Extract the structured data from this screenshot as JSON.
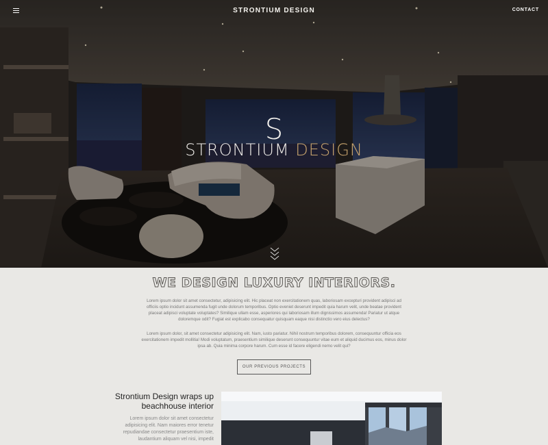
{
  "header": {
    "menu_icon": "hamburger-menu-icon",
    "brand": "STRONTIUM DESIGN",
    "contact": "CONTACT"
  },
  "hero": {
    "logo_letter": "S",
    "logo_word_1": "STRONTIUM",
    "logo_word_2": "DESIGN",
    "scroll_icon": "chevron-down-icon"
  },
  "intro": {
    "headline": "WE DESIGN LUXURY INTERIORS.",
    "paragraph_1": "Lorem ipsum dolor sit amet consectetur, adipisicing elit. Hic placeat non exercitationem quas, laboriosam excepturi provident adipisci ad officiis optio incidunt assumenda fugit unde dolorum temporibus. Optio eveniet deserunt impedit quia harum velit, unde beatae provident placeat adipisci voluptate voluptates? Similique ullam esse, asperiores qui laboriosam illum dignissimos assumenda! Pariatur ut atque doloremque odit? Fugiat est explicabo consequatur quisquam eaque nisi distinctio vero eius delectus?",
    "paragraph_2": "Lorem ipsum dolor, sit amet consectetur adipisicing elit. Nam, iusto pariatur. Nihil nostrum temporibus dolorem, consequuntur officia eos exercitationem impedit mollitia! Modi voluptatum, praesentium similique deserunt consequuntur vitae eum et aliquid ducimus eos, minus dolor ipsa ab. Quia minima corpore harum. Cum esse id facere eligendi nemo velit qui?",
    "button": "OUR PREVIOUS PROJECTS"
  },
  "feature": {
    "title": "Strontium Design wraps up beachhouse interior",
    "text": "Lorem ipsum dolor sit amet consectetur adipisicing elit. Nam maiores error tenetur repudiandae consectetur praesentium iste, laudantium aliquam vel nisi, impedit"
  },
  "colors": {
    "accent_gold": "#c9a56e",
    "page_bg": "#e9e8e5"
  }
}
